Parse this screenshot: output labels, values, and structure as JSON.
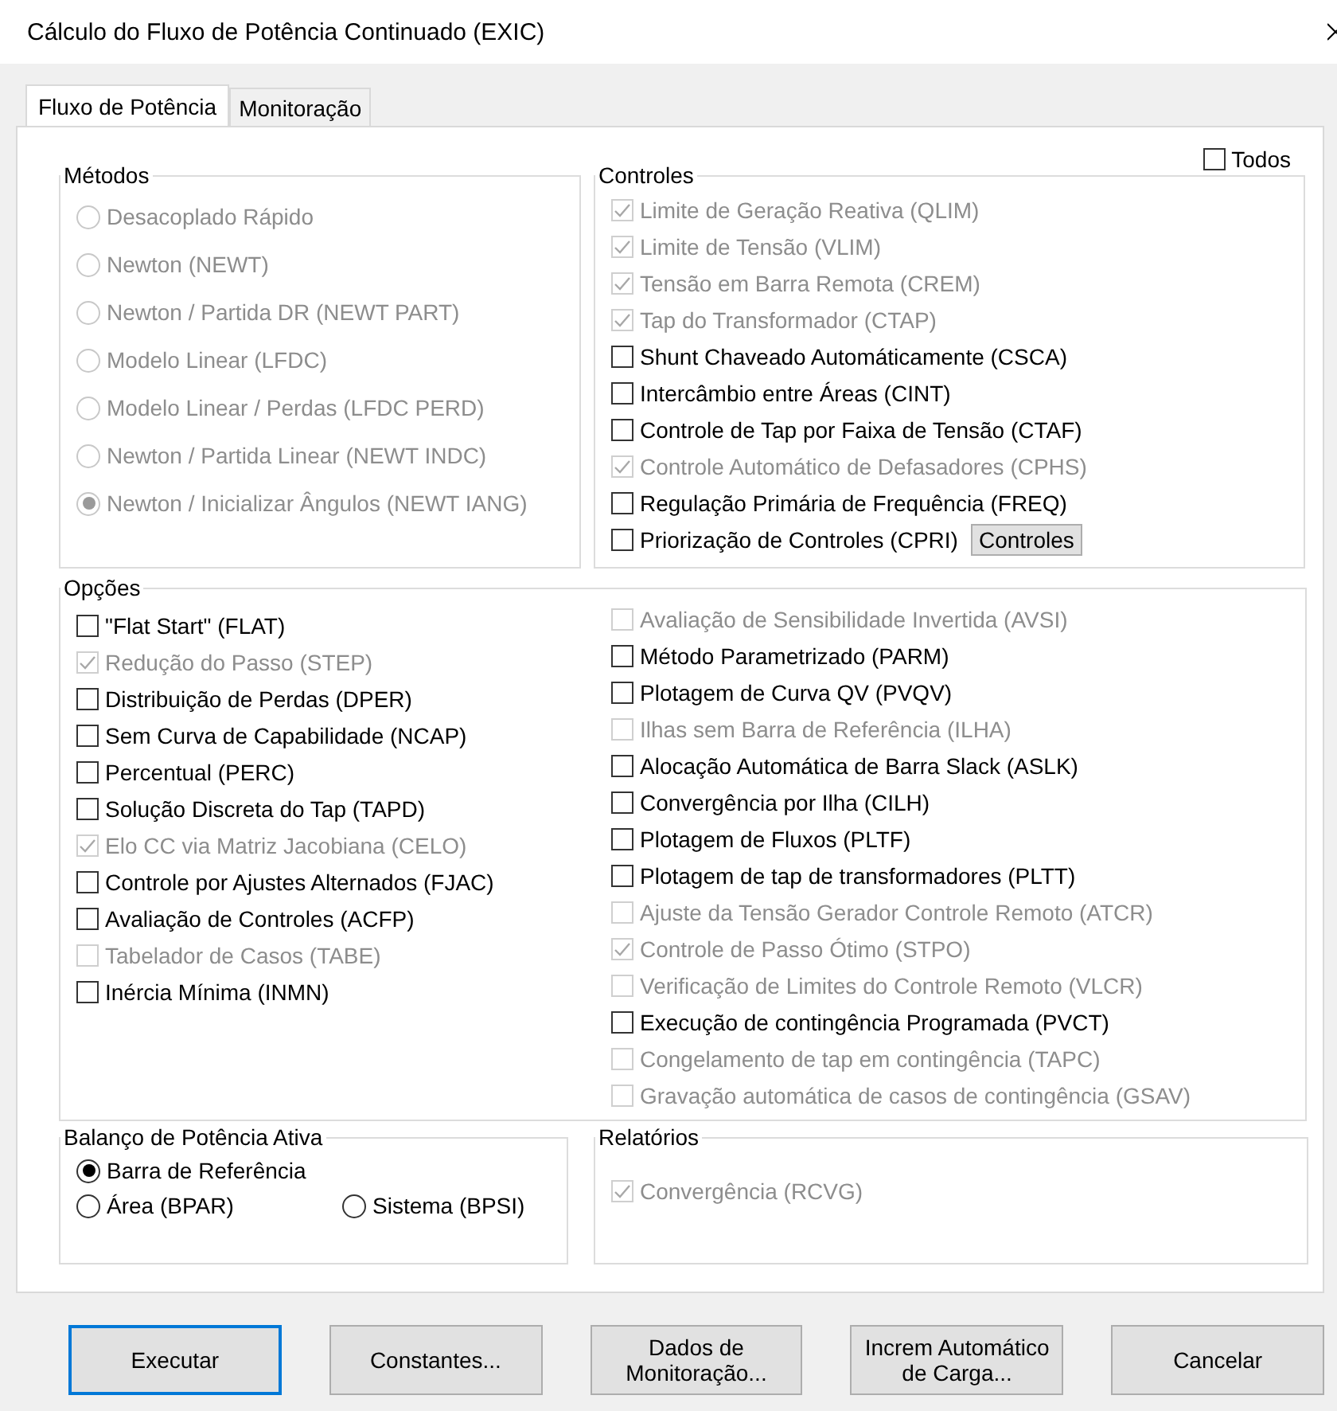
{
  "window": {
    "title": "Cálculo do Fluxo de Potência Continuado (EXIC)"
  },
  "tabs": [
    {
      "label": "Fluxo de Potência",
      "selected": true
    },
    {
      "label": "Monitoração",
      "selected": false
    }
  ],
  "todos": {
    "label": "Todos",
    "checked": false
  },
  "metodos": {
    "title": "Métodos",
    "items": [
      {
        "label": "Desacoplado Rápido",
        "selected": false,
        "disabled": true
      },
      {
        "label": "Newton (NEWT)",
        "selected": false,
        "disabled": true
      },
      {
        "label": "Newton / Partida DR (NEWT PART)",
        "selected": false,
        "disabled": true
      },
      {
        "label": "Modelo Linear (LFDC)",
        "selected": false,
        "disabled": true
      },
      {
        "label": "Modelo Linear / Perdas (LFDC PERD)",
        "selected": false,
        "disabled": true
      },
      {
        "label": "Newton / Partida Linear (NEWT INDC)",
        "selected": false,
        "disabled": true
      },
      {
        "label": "Newton / Inicializar Ângulos (NEWT IANG)",
        "selected": true,
        "disabled": true
      }
    ]
  },
  "controles": {
    "title": "Controles",
    "button": "Controles",
    "items": [
      {
        "label": "Limite de Geração Reativa (QLIM)",
        "checked": true,
        "disabled": true
      },
      {
        "label": "Limite de Tensão (VLIM)",
        "checked": true,
        "disabled": true
      },
      {
        "label": "Tensão em Barra Remota (CREM)",
        "checked": true,
        "disabled": true
      },
      {
        "label": "Tap do Transformador (CTAP)",
        "checked": true,
        "disabled": true
      },
      {
        "label": "Shunt Chaveado Automáticamente (CSCA)",
        "checked": false,
        "disabled": false
      },
      {
        "label": "Intercâmbio entre Áreas (CINT)",
        "checked": false,
        "disabled": false
      },
      {
        "label": "Controle de Tap por Faixa de Tensão (CTAF)",
        "checked": false,
        "disabled": false
      },
      {
        "label": "Controle Automático de Defasadores (CPHS)",
        "checked": true,
        "disabled": true
      },
      {
        "label": "Regulação Primária de Frequência (FREQ)",
        "checked": false,
        "disabled": false
      },
      {
        "label": "Priorização de Controles (CPRI)",
        "checked": false,
        "disabled": false
      }
    ]
  },
  "opcoes": {
    "title": "Opções",
    "left": [
      {
        "label": "\"Flat Start\" (FLAT)",
        "checked": false,
        "disabled": false
      },
      {
        "label": "Redução do Passo (STEP)",
        "checked": true,
        "disabled": true
      },
      {
        "label": "Distribuição de Perdas (DPER)",
        "checked": false,
        "disabled": false
      },
      {
        "label": "Sem Curva de Capabilidade (NCAP)",
        "checked": false,
        "disabled": false
      },
      {
        "label": "Percentual (PERC)",
        "checked": false,
        "disabled": false
      },
      {
        "label": "Solução Discreta do Tap (TAPD)",
        "checked": false,
        "disabled": false
      },
      {
        "label": "Elo CC via Matriz Jacobiana (CELO)",
        "checked": true,
        "disabled": true
      },
      {
        "label": "Controle por Ajustes Alternados (FJAC)",
        "checked": false,
        "disabled": false
      },
      {
        "label": "Avaliação de Controles (ACFP)",
        "checked": false,
        "disabled": false
      },
      {
        "label": "Tabelador de Casos (TABE)",
        "checked": false,
        "disabled": true
      },
      {
        "label": "Inércia Mínima (INMN)",
        "checked": false,
        "disabled": false
      }
    ],
    "right": [
      {
        "label": "Avaliação de Sensibilidade Invertida (AVSI)",
        "checked": false,
        "disabled": true
      },
      {
        "label": "Método Parametrizado (PARM)",
        "checked": false,
        "disabled": false
      },
      {
        "label": "Plotagem de Curva QV (PVQV)",
        "checked": false,
        "disabled": false
      },
      {
        "label": "Ilhas sem Barra de Referência (ILHA)",
        "checked": false,
        "disabled": true
      },
      {
        "label": "Alocação Automática de Barra Slack (ASLK)",
        "checked": false,
        "disabled": false
      },
      {
        "label": "Convergência por Ilha (CILH)",
        "checked": false,
        "disabled": false
      },
      {
        "label": "Plotagem de Fluxos (PLTF)",
        "checked": false,
        "disabled": false
      },
      {
        "label": "Plotagem de tap de transformadores (PLTT)",
        "checked": false,
        "disabled": false
      },
      {
        "label": "Ajuste da Tensão Gerador Controle Remoto (ATCR)",
        "checked": false,
        "disabled": true
      },
      {
        "label": "Controle de Passo Ótimo (STPO)",
        "checked": true,
        "disabled": true
      },
      {
        "label": "Verificação de Limites do Controle Remoto (VLCR)",
        "checked": false,
        "disabled": true
      },
      {
        "label": "Execução de contingência Programada (PVCT)",
        "checked": false,
        "disabled": false
      },
      {
        "label": "Congelamento de tap em contingência (TAPC)",
        "checked": false,
        "disabled": true
      },
      {
        "label": "Gravação automática de casos de contingência (GSAV)",
        "checked": false,
        "disabled": true
      }
    ]
  },
  "balanco": {
    "title": "Balanço de Potência Ativa",
    "items": [
      {
        "label": "Barra de Referência",
        "selected": true,
        "disabled": false
      },
      {
        "label": "Área (BPAR)",
        "selected": false,
        "disabled": false
      },
      {
        "label": "Sistema (BPSI)",
        "selected": false,
        "disabled": false
      }
    ]
  },
  "relatorios": {
    "title": "Relatórios",
    "items": [
      {
        "label": "Convergência (RCVG)",
        "checked": true,
        "disabled": true
      }
    ]
  },
  "buttons": [
    {
      "label": "Executar",
      "default": true
    },
    {
      "label": "Constantes...",
      "default": false
    },
    {
      "label": "Dados de\nMonitoração...",
      "default": false
    },
    {
      "label": "Increm Automático\nde Carga...",
      "default": false
    },
    {
      "label": "Cancelar",
      "default": false
    }
  ]
}
